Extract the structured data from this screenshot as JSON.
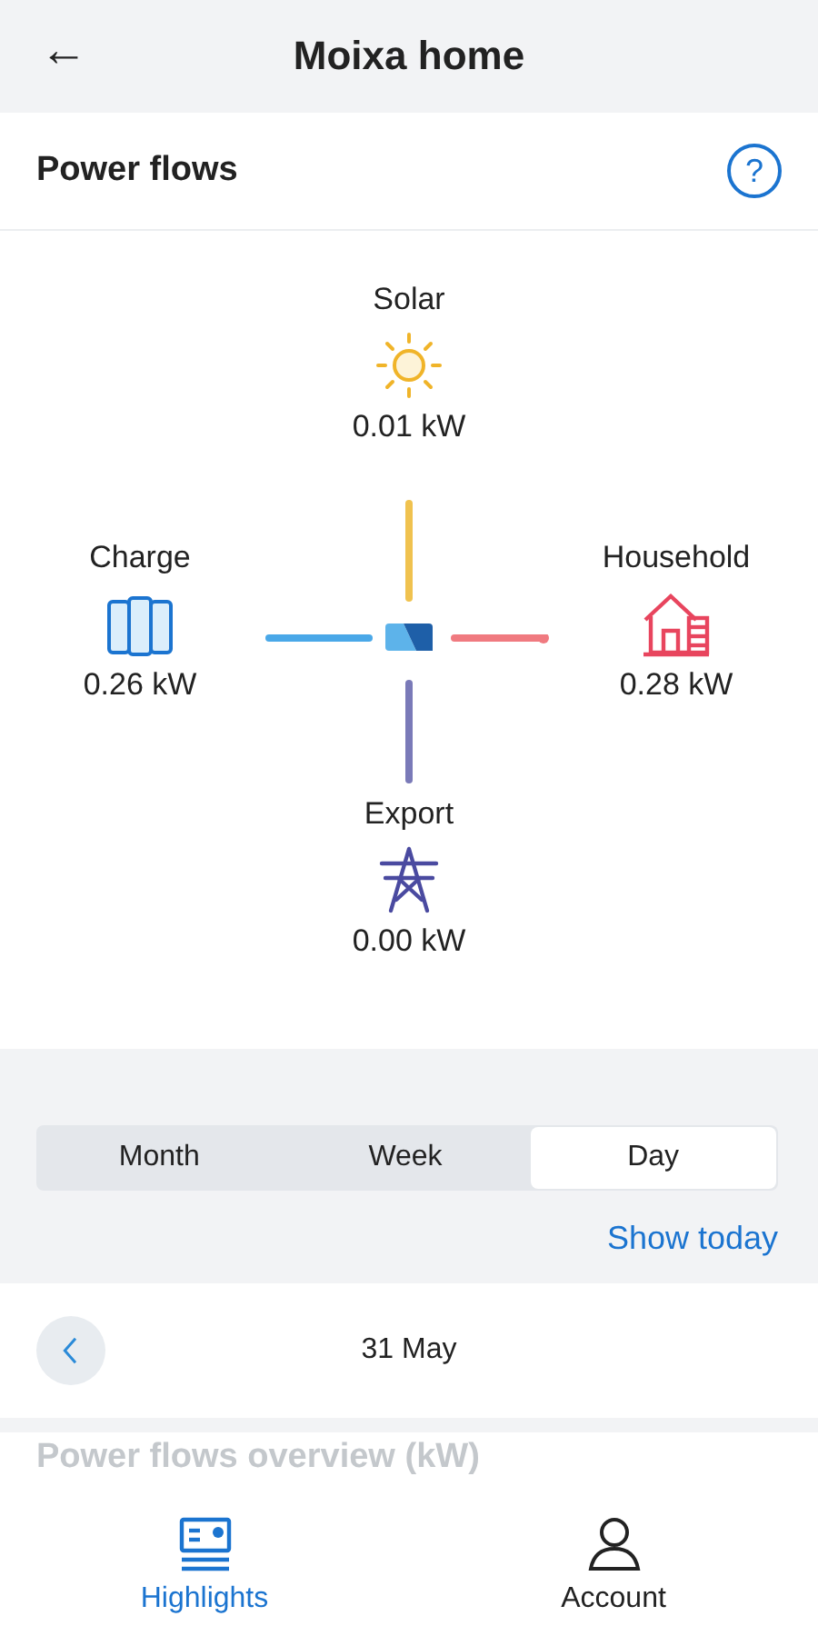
{
  "header": {
    "back": "←",
    "title": "Moixa home"
  },
  "power_flows": {
    "title": "Power flows",
    "help": "?",
    "nodes": [
      {
        "kind": "solar",
        "label": "Solar",
        "value": "0.01 kW",
        "color": "#f0c24f"
      },
      {
        "kind": "charge",
        "label": "Charge",
        "value": "0.26 kW",
        "color": "#4aa8e8"
      },
      {
        "kind": "household",
        "label": "Household",
        "value": "0.28 kW",
        "color": "#f07a80"
      },
      {
        "kind": "export",
        "label": "Export",
        "value": "0.00 kW",
        "color": "#7a7ab8"
      }
    ]
  },
  "period_tabs": [
    {
      "label": "Month",
      "selected": false
    },
    {
      "label": "Week",
      "selected": false
    },
    {
      "label": "Day",
      "selected": true
    }
  ],
  "show_today": "Show today",
  "date": "31 May",
  "overview_title": "Power flows overview (kW)",
  "nav": [
    {
      "kind": "highlights",
      "label": "Highlights",
      "selected": true
    },
    {
      "kind": "account",
      "label": "Account",
      "selected": false
    }
  ]
}
